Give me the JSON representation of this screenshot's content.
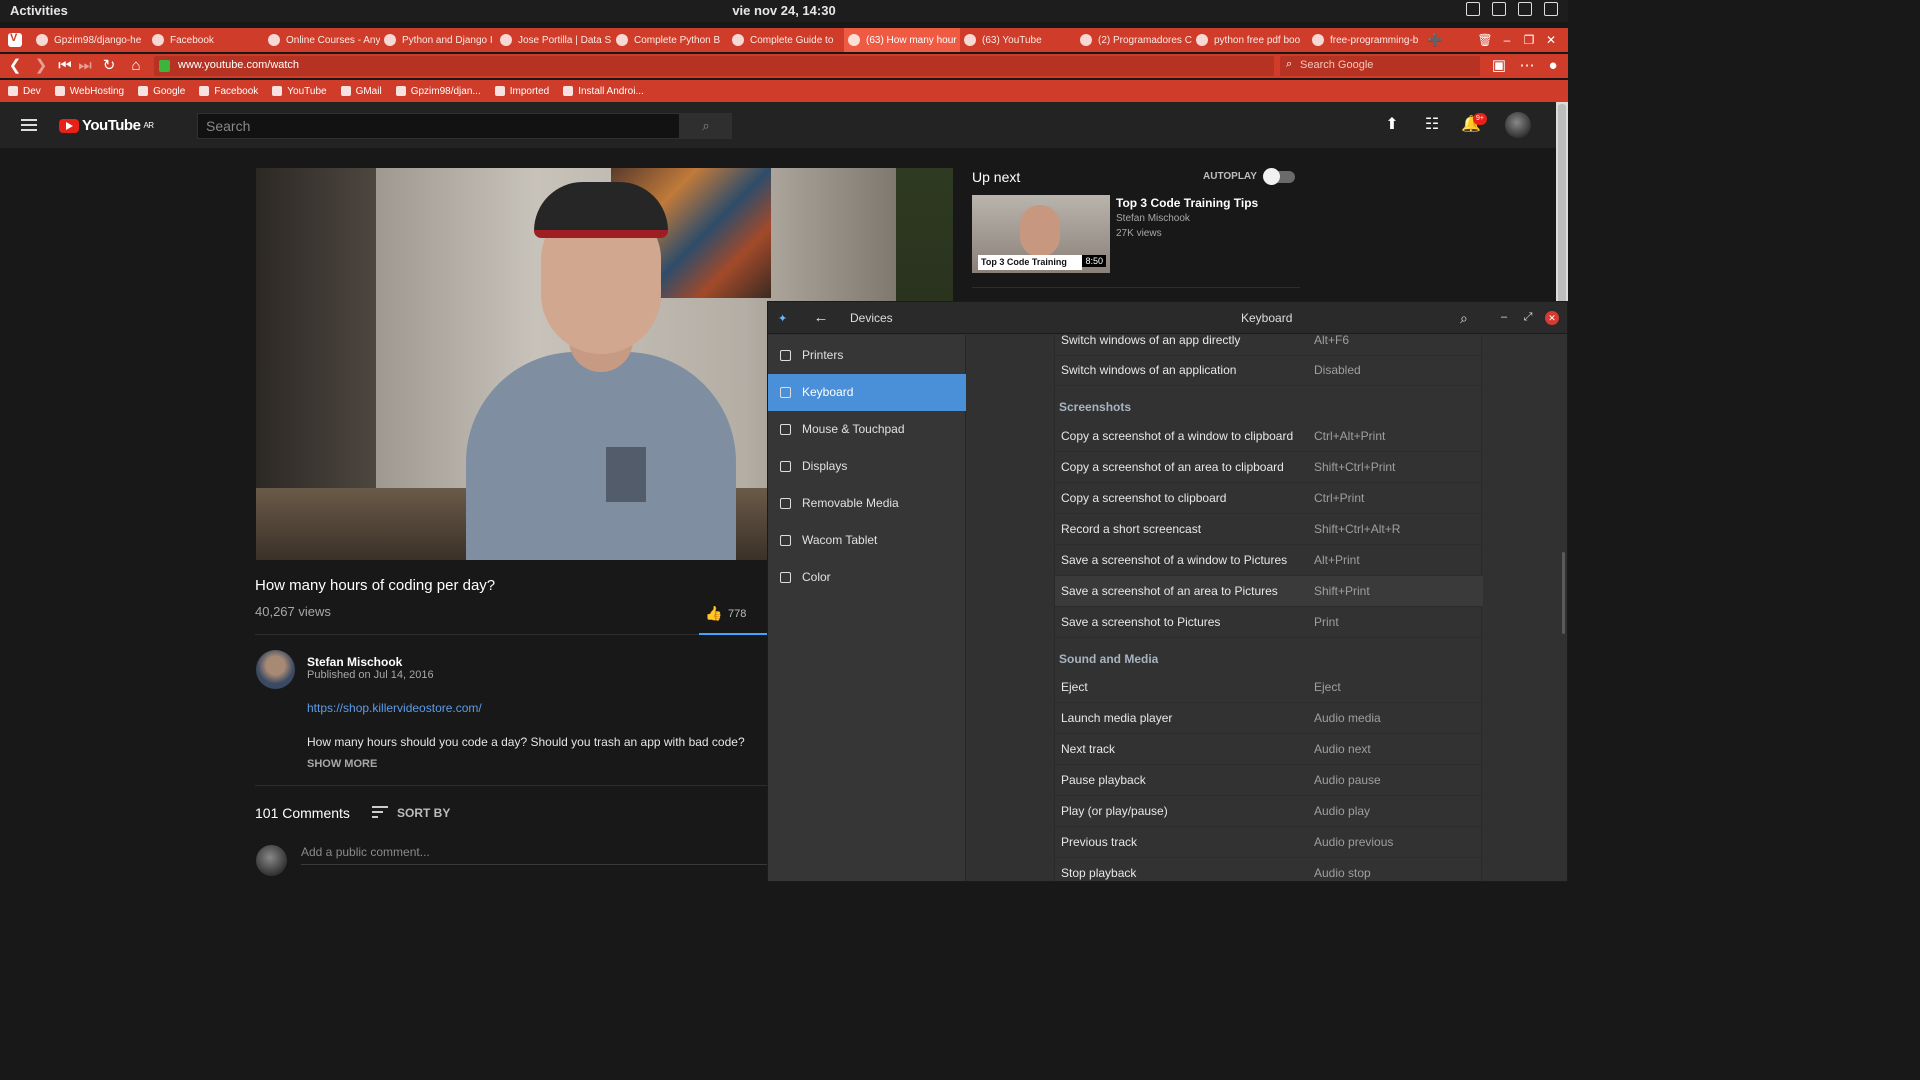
{
  "system": {
    "activities": "Activities",
    "clock": "vie nov 24, 14:30"
  },
  "browser": {
    "tabs": [
      {
        "label": "Gpzim98/django-he"
      },
      {
        "label": "Facebook"
      },
      {
        "label": "Online Courses - Any"
      },
      {
        "label": "Python and Django I"
      },
      {
        "label": "Jose Portilla | Data S"
      },
      {
        "label": "Complete Python B"
      },
      {
        "label": "Complete Guide to"
      },
      {
        "label": "(63) How many hour"
      },
      {
        "label": "(63) YouTube"
      },
      {
        "label": "(2) Programadores C"
      },
      {
        "label": "python free pdf boo"
      },
      {
        "label": "free-programming-b"
      }
    ],
    "url": "www.youtube.com/watch",
    "search_placeholder": "Search Google",
    "bookmarks": [
      {
        "label": "Dev"
      },
      {
        "label": "WebHosting"
      },
      {
        "label": "Google"
      },
      {
        "label": "Facebook"
      },
      {
        "label": "YouTube"
      },
      {
        "label": "GMail"
      },
      {
        "label": "Gpzim98/djan..."
      },
      {
        "label": "Imported"
      },
      {
        "label": "Install Androi..."
      }
    ],
    "accent_color": "#cf3c2a"
  },
  "youtube": {
    "logo_text": "YouTube",
    "region": "AR",
    "search_placeholder": "Search",
    "notification_count": "9+",
    "video": {
      "title": "How many hours of coding per day?",
      "views": "40,267 views",
      "likes": "778"
    },
    "channel": {
      "name": "Stefan Mischook",
      "published": "Published on Jul 14, 2016",
      "link": "https://shop.killervideostore.com/",
      "description": "How many hours should you code a day? Should you trash an app with bad code?",
      "show_more": "SHOW MORE"
    },
    "comments": {
      "count": "101 Comments",
      "sort_label": "SORT BY",
      "placeholder": "Add a public comment..."
    },
    "upnext": {
      "heading": "Up next",
      "autoplay_label": "AUTOPLAY",
      "item": {
        "title": "Top 3 Code Training Tips",
        "channel": "Stefan Mischook",
        "views": "27K views",
        "thumb_text": "Top 3 Code Training",
        "duration": "8:50"
      }
    }
  },
  "settings": {
    "back_title": "Devices",
    "panel_title": "Keyboard",
    "sidebar": [
      {
        "label": "Printers"
      },
      {
        "label": "Keyboard"
      },
      {
        "label": "Mouse & Touchpad"
      },
      {
        "label": "Displays"
      },
      {
        "label": "Removable Media"
      },
      {
        "label": "Wacom Tablet"
      },
      {
        "label": "Color"
      }
    ],
    "shortcuts_top": [
      {
        "name": "Switch windows of an app directly",
        "value": "Alt+F6"
      },
      {
        "name": "Switch windows of an application",
        "value": "Disabled"
      }
    ],
    "section_screenshots": "Screenshots",
    "screenshots": [
      {
        "name": "Copy a screenshot of a window to clipboard",
        "value": "Ctrl+Alt+Print"
      },
      {
        "name": "Copy a screenshot of an area to clipboard",
        "value": "Shift+Ctrl+Print"
      },
      {
        "name": "Copy a screenshot to clipboard",
        "value": "Ctrl+Print"
      },
      {
        "name": "Record a short screencast",
        "value": "Shift+Ctrl+Alt+R"
      },
      {
        "name": "Save a screenshot of a window to Pictures",
        "value": "Alt+Print"
      },
      {
        "name": "Save a screenshot of an area to Pictures",
        "value": "Shift+Print"
      },
      {
        "name": "Save a screenshot to Pictures",
        "value": "Print"
      }
    ],
    "section_sound": "Sound and Media",
    "sound": [
      {
        "name": "Eject",
        "value": "Eject"
      },
      {
        "name": "Launch media player",
        "value": "Audio media"
      },
      {
        "name": "Next track",
        "value": "Audio next"
      },
      {
        "name": "Pause playback",
        "value": "Audio pause"
      },
      {
        "name": "Play (or play/pause)",
        "value": "Audio play"
      },
      {
        "name": "Previous track",
        "value": "Audio previous"
      },
      {
        "name": "Stop playback",
        "value": "Audio stop"
      }
    ],
    "selection_color": "#4a90d9"
  }
}
